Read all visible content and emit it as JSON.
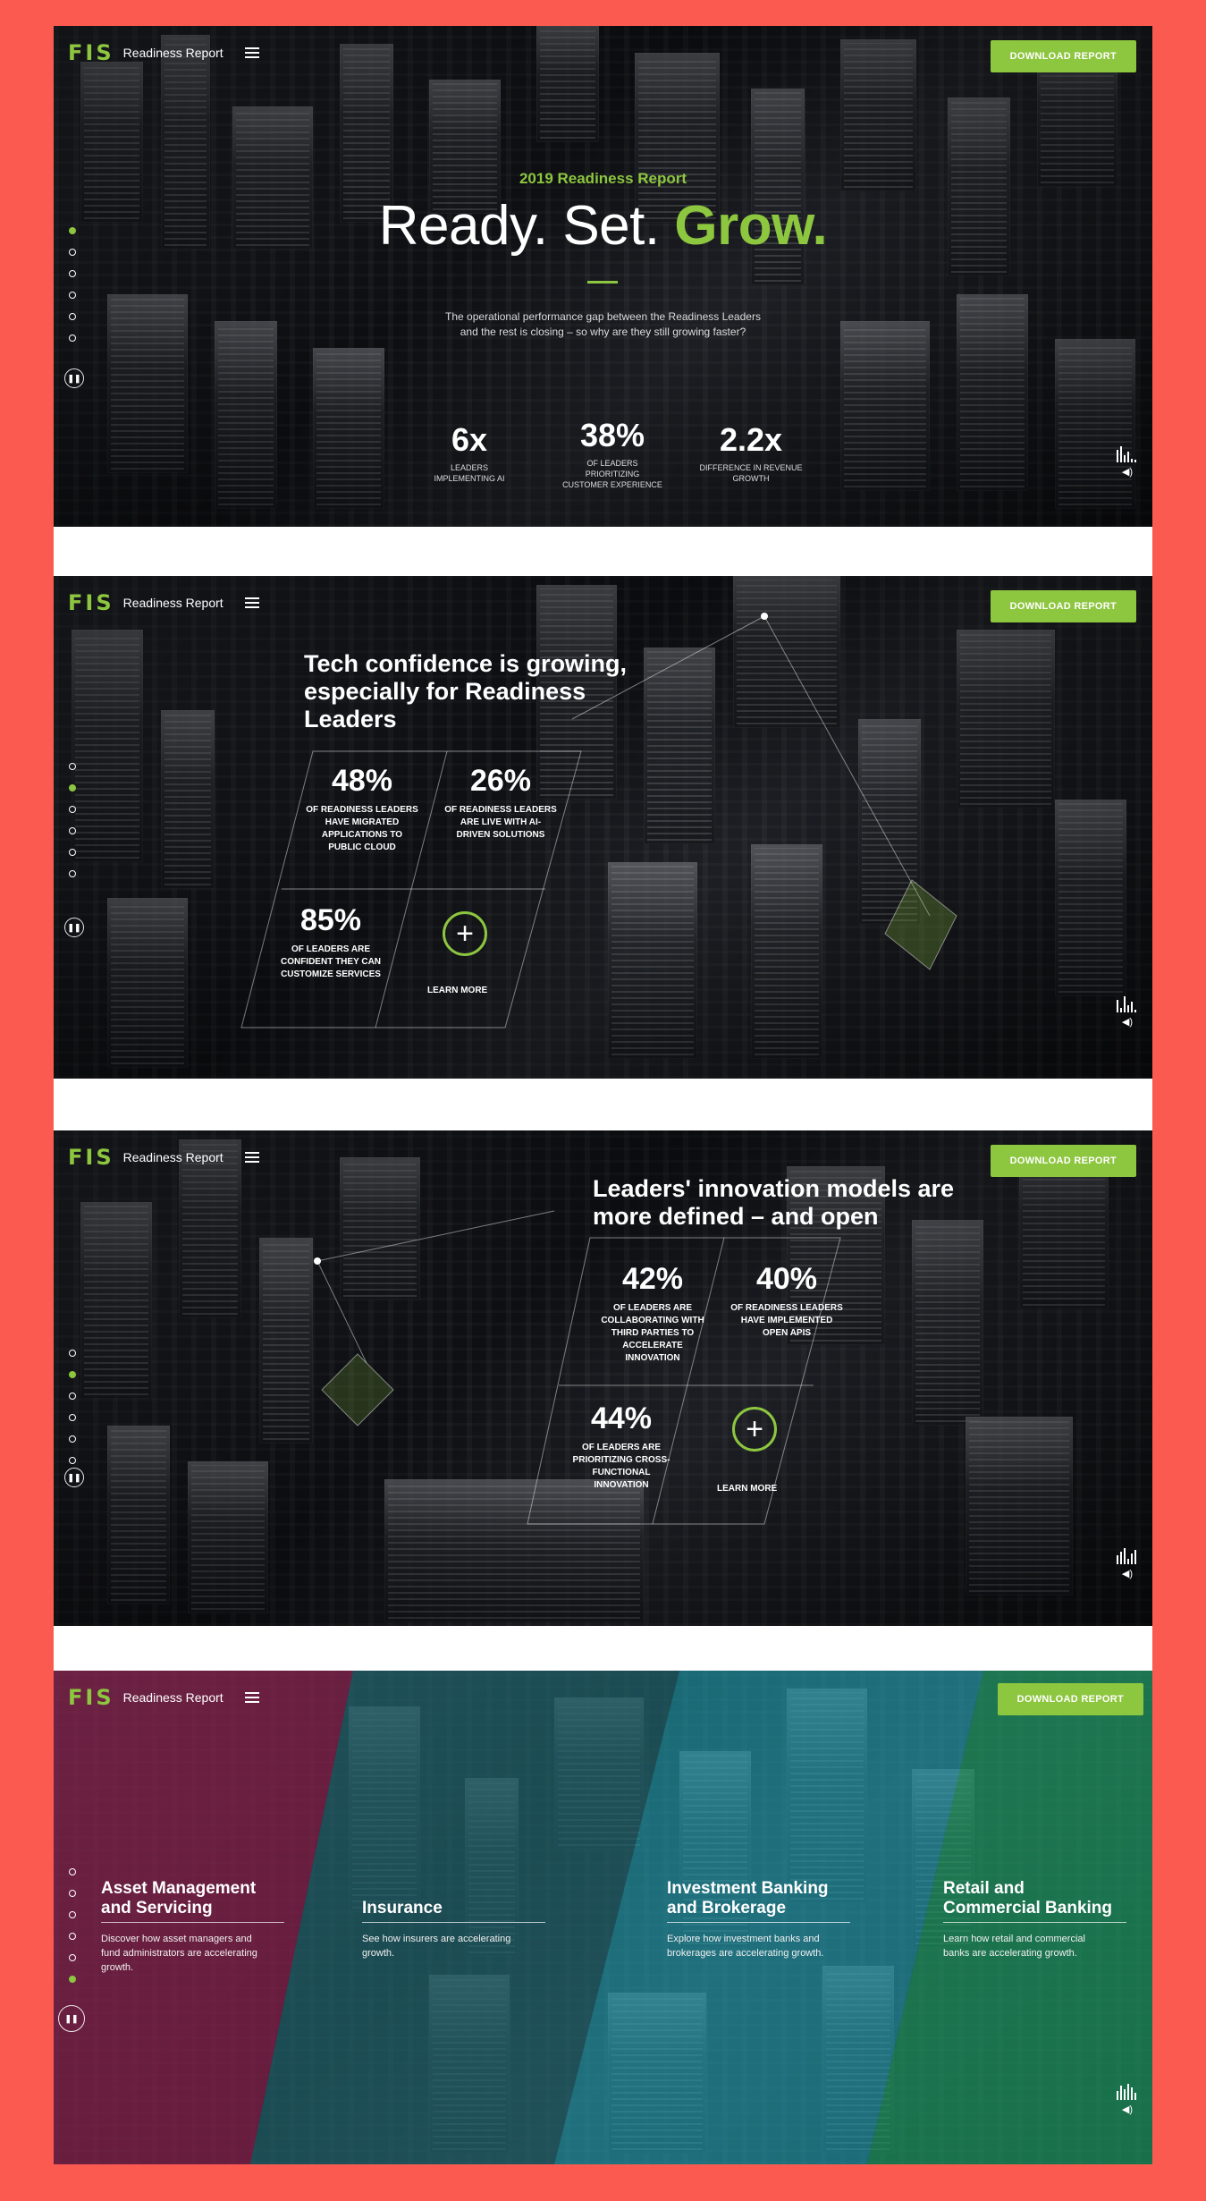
{
  "brand": {
    "logo_mark": "FIS",
    "report_name": "Readiness Report",
    "download_label": "DOWNLOAD REPORT"
  },
  "hero": {
    "kicker": "2019 Readiness Report",
    "title_part1": "Ready. Set. ",
    "title_part2": "Grow.",
    "subtitle_line1": "The operational performance gap between the Readiness Leaders",
    "subtitle_line2": "and the rest is closing – so why are they still growing faster?",
    "stats": [
      {
        "value": "6x",
        "label_line1": "LEADERS",
        "label_line2": "IMPLEMENTING AI",
        "label_line3": ""
      },
      {
        "value": "38%",
        "label_line1": "OF LEADERS",
        "label_line2": "PRIORITIZING",
        "label_line3": "CUSTOMER EXPERIENCE"
      },
      {
        "value": "2.2x",
        "label_line1": "DIFFERENCE IN REVENUE",
        "label_line2": "GROWTH",
        "label_line3": ""
      }
    ]
  },
  "tech": {
    "title_line1": "Tech confidence is growing,",
    "title_line2": "especially for Readiness",
    "title_line3": "Leaders",
    "stats": [
      {
        "value": "48%",
        "label_line1": "OF READINESS LEADERS",
        "label_line2": "HAVE MIGRATED",
        "label_line3": "APPLICATIONS TO",
        "label_line4": "PUBLIC CLOUD"
      },
      {
        "value": "26%",
        "label_line1": "OF READINESS LEADERS",
        "label_line2": "ARE LIVE WITH AI-",
        "label_line3": "DRIVEN SOLUTIONS",
        "label_line4": ""
      },
      {
        "value": "85%",
        "label_line1": "OF LEADERS ARE",
        "label_line2": "CONFIDENT THEY CAN",
        "label_line3": "CUSTOMIZE SERVICES",
        "label_line4": ""
      }
    ],
    "learn_more": "LEARN MORE"
  },
  "innovation": {
    "title_line1": "Leaders' innovation models are",
    "title_line2": "more defined – and open",
    "stats": [
      {
        "value": "42%",
        "label_line1": "OF LEADERS ARE",
        "label_line2": "COLLABORATING WITH",
        "label_line3": "THIRD PARTIES TO",
        "label_line4": "ACCELERATE",
        "label_line5": "INNOVATION"
      },
      {
        "value": "40%",
        "label_line1": "OF READINESS LEADERS",
        "label_line2": "HAVE IMPLEMENTED",
        "label_line3": "OPEN APIS",
        "label_line4": "",
        "label_line5": ""
      },
      {
        "value": "44%",
        "label_line1": "OF LEADERS ARE",
        "label_line2": "PRIORITIZING CROSS-",
        "label_line3": "FUNCTIONAL",
        "label_line4": "INNOVATION",
        "label_line5": ""
      }
    ],
    "learn_more": "LEARN MORE"
  },
  "industries": [
    {
      "title_line1": "Asset Management",
      "title_line2": "and Servicing",
      "desc_line1": "Discover how asset managers and",
      "desc_line2": "fund administrators are accelerating",
      "desc_line3": "growth.",
      "color": "#7a1f45"
    },
    {
      "title_line1": "",
      "title_line2": "Insurance",
      "desc_line1": "See how insurers are accelerating",
      "desc_line2": "growth.",
      "desc_line3": "",
      "color": "#1f5b63"
    },
    {
      "title_line1": "Investment Banking",
      "title_line2": "and Brokerage",
      "desc_line1": "Explore how investment banks and",
      "desc_line2": "brokerages are accelerating growth.",
      "desc_line3": "",
      "color": "#1d8a9a"
    },
    {
      "title_line1": "Retail and",
      "title_line2": "Commercial Banking",
      "desc_line1": "Learn how retail and commercial",
      "desc_line2": "banks are accelerating growth.",
      "desc_line3": "",
      "color": "#1b8a5a"
    }
  ],
  "colors": {
    "accent": "#8dc63f",
    "frame": "#fb5a50"
  },
  "icons": {
    "pause": "pause-icon",
    "menu": "hamburger-icon",
    "equalizer": "equalizer-icon",
    "volume": "volume-icon"
  }
}
